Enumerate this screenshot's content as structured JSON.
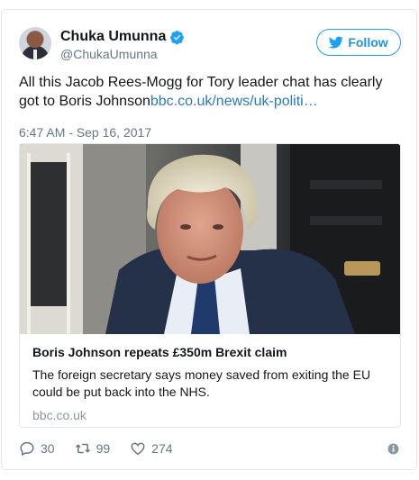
{
  "author": {
    "name": "Chuka Umunna",
    "handle": "@ChukaUmunna"
  },
  "follow_label": "Follow",
  "tweet": {
    "text": "All this Jacob Rees-Mogg for Tory leader chat has clearly got to Boris Johnson",
    "link_text": "bbc.co.uk/news/uk-politi…",
    "timestamp": "6:47 AM - Sep 16, 2017"
  },
  "card": {
    "title": "Boris Johnson repeats £350m Brexit claim",
    "description": "The foreign secretary says money saved from exiting the EU could be put back into the NHS.",
    "domain": "bbc.co.uk"
  },
  "actions": {
    "replies": "30",
    "retweets": "99",
    "likes": "274"
  },
  "colors": {
    "brand_blue": "#1da1f2",
    "link_blue": "#2b7bb9",
    "muted_gray": "#657786",
    "border": "#e1e8ed"
  },
  "icons": [
    "verified-badge-icon",
    "twitter-bird-icon",
    "reply-icon",
    "retweet-icon",
    "heart-icon",
    "info-icon"
  ]
}
